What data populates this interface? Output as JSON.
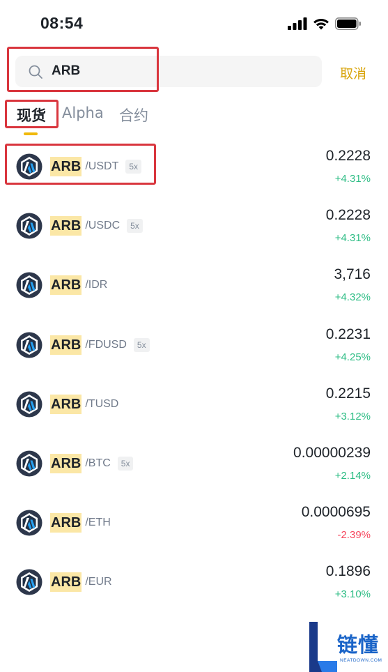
{
  "status_bar": {
    "time": "08:54"
  },
  "search": {
    "value": "ARB",
    "cancel_label": "取消"
  },
  "tabs": [
    {
      "label": "现货",
      "active": true
    },
    {
      "label": "Alpha",
      "active": false
    },
    {
      "label": "合约",
      "active": false
    }
  ],
  "markets": [
    {
      "base": "ARB",
      "quote": "/USDT",
      "leverage": "5x",
      "price": "0.2228",
      "change": "+4.31%",
      "direction": "up"
    },
    {
      "base": "ARB",
      "quote": "/USDC",
      "leverage": "5x",
      "price": "0.2228",
      "change": "+4.31%",
      "direction": "up"
    },
    {
      "base": "ARB",
      "quote": "/IDR",
      "leverage": "",
      "price": "3,716",
      "change": "+4.32%",
      "direction": "up"
    },
    {
      "base": "ARB",
      "quote": "/FDUSD",
      "leverage": "5x",
      "price": "0.2231",
      "change": "+4.25%",
      "direction": "up"
    },
    {
      "base": "ARB",
      "quote": "/TUSD",
      "leverage": "",
      "price": "0.2215",
      "change": "+3.12%",
      "direction": "up"
    },
    {
      "base": "ARB",
      "quote": "/BTC",
      "leverage": "5x",
      "price": "0.00000239",
      "change": "+2.14%",
      "direction": "up"
    },
    {
      "base": "ARB",
      "quote": "/ETH",
      "leverage": "",
      "price": "0.0000695",
      "change": "-2.39%",
      "direction": "down"
    },
    {
      "base": "ARB",
      "quote": "/EUR",
      "leverage": "",
      "price": "0.1896",
      "change": "+3.10%",
      "direction": "up"
    }
  ],
  "watermark": {
    "brand_cn": "链懂",
    "brand_en": "NEATDOWN.COM"
  },
  "colors": {
    "accent": "#f0b90b",
    "cancel": "#d8a40a",
    "up": "#2ebd85",
    "down": "#f6465d",
    "highlight_box": "#d9363e"
  },
  "icons": {
    "coin": "arbitrum-logo-icon",
    "search": "search-icon",
    "signal": "cellular-signal-icon",
    "wifi": "wifi-icon",
    "battery": "battery-icon"
  }
}
